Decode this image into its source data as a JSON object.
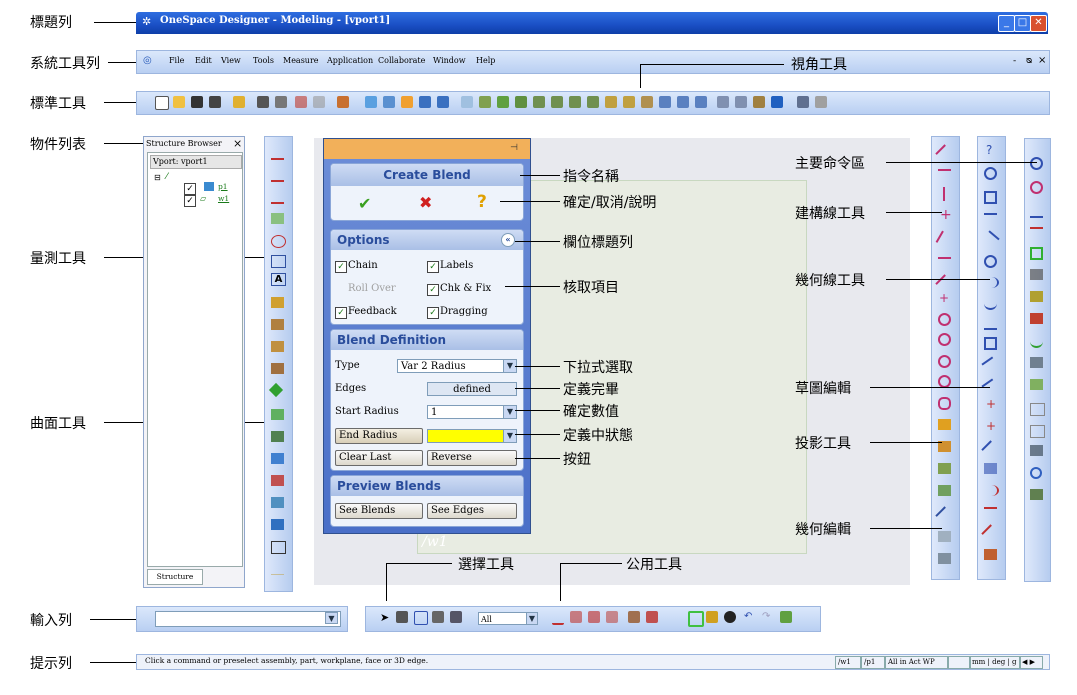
{
  "window": {
    "title": "OneSpace Designer - Modeling - [vport1]",
    "buttons": [
      "_",
      "□",
      "✕"
    ]
  },
  "menubar": {
    "items": [
      "File",
      "Edit",
      "View",
      "Tools",
      "Measure",
      "Application",
      "Collaborate",
      "Window",
      "Help"
    ],
    "controls": [
      "-",
      "ᴓ",
      "×"
    ]
  },
  "structure_browser": {
    "title": "Structure Browser",
    "close": "×",
    "root": "Vport: vport1",
    "nodes": [
      "p1",
      "w1"
    ],
    "tab": "Structure"
  },
  "dialog": {
    "pin": "⊣",
    "command_name": "Create Blend",
    "ok": "✔",
    "cancel": "✖",
    "help": "?",
    "options": {
      "title": "Options",
      "chain": "Chain",
      "labels": "Labels",
      "roll_over": "Roll Over",
      "chk_fix": "Chk & Fix",
      "feedback": "Feedback",
      "dragging": "Dragging"
    },
    "definition": {
      "title": "Blend Definition",
      "type_label": "Type",
      "type_value": "Var 2 Radius",
      "edges_label": "Edges",
      "edges_value": "defined",
      "start_radius_label": "Start Radius",
      "start_radius_value": "1",
      "end_radius_button": "End Radius",
      "clear_last": "Clear Last",
      "reverse": "Reverse"
    },
    "preview": {
      "title": "Preview Blends",
      "see_blends": "See Blends",
      "see_edges": "See Edges"
    }
  },
  "canvas": {
    "workplane_label": "/w1"
  },
  "select_bar": {
    "filter_value": "All"
  },
  "status_bar": {
    "message": "Click a command or preselect assembly, part, workplane, face or 3D edge.",
    "fields": [
      "/w1",
      "/p1",
      "All in Act WP",
      "",
      "mm | deg | g",
      "◀ ▶"
    ]
  },
  "annotations": {
    "title_bar": "標題列",
    "system_toolbar": "系統工具列",
    "standard_tools": "標準工具",
    "structure_list": "物件列表",
    "measure_tools": "量測工具",
    "surface_tools": "曲面工具",
    "input_bar": "輸入列",
    "prompt_bar": "提示列",
    "view_tools": "視角工具",
    "command_name": "指令名稱",
    "ok_cancel_help": "確定/取消/說明",
    "section_title_bar": "欄位標題列",
    "check_items": "核取項目",
    "dropdown_select": "下拉式選取",
    "definition_done": "定義完畢",
    "confirm_value": "確定數值",
    "defining_state": "定義中狀態",
    "button": "按鈕",
    "select_tools": "選擇工具",
    "utility_tools": "公用工具",
    "main_command_area": "主要命令區",
    "construction_tools": "建構線工具",
    "geometry_tools": "幾何線工具",
    "sketch_edit": "草圖編輯",
    "projection_tools": "投影工具",
    "geometry_edit": "幾何編輯"
  },
  "colors": {
    "title_bar": "#1a4fc4",
    "dialog_bg": "#5a7fd0",
    "defining_field": "#ffff00",
    "accent_orange": "#f2b05a"
  }
}
